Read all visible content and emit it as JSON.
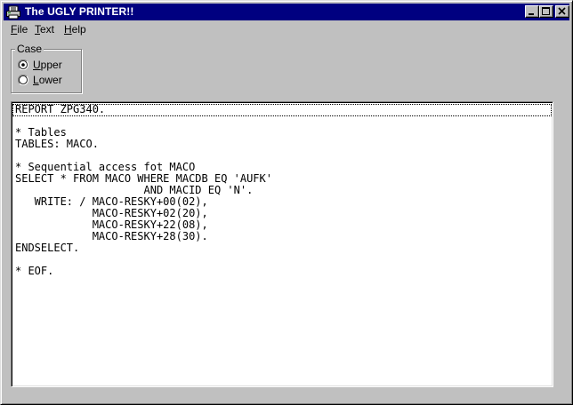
{
  "window": {
    "title": "The UGLY PRINTER!!"
  },
  "menu": {
    "items": [
      {
        "label": "File"
      },
      {
        "label": "Text"
      },
      {
        "label": "Help"
      }
    ]
  },
  "case_group": {
    "label": "Case",
    "options": [
      {
        "label": "Upper",
        "selected": true
      },
      {
        "label": "Lower",
        "selected": false
      }
    ]
  },
  "editor": {
    "lines": [
      "REPORT ZPG340.",
      "",
      "* Tables",
      "TABLES: MACO.",
      "",
      "* Sequential access fot MACO",
      "SELECT * FROM MACO WHERE MACDB EQ 'AUFK'",
      "                    AND MACID EQ 'N'.",
      "   WRITE: / MACO-RESKY+00(02),",
      "            MACO-RESKY+02(20),",
      "            MACO-RESKY+22(08),",
      "            MACO-RESKY+28(30).",
      "ENDSELECT.",
      "",
      "* EOF."
    ]
  },
  "icons": {
    "app": "printer-icon",
    "minimize": "minimize-icon",
    "maximize": "maximize-icon",
    "close": "close-icon"
  }
}
